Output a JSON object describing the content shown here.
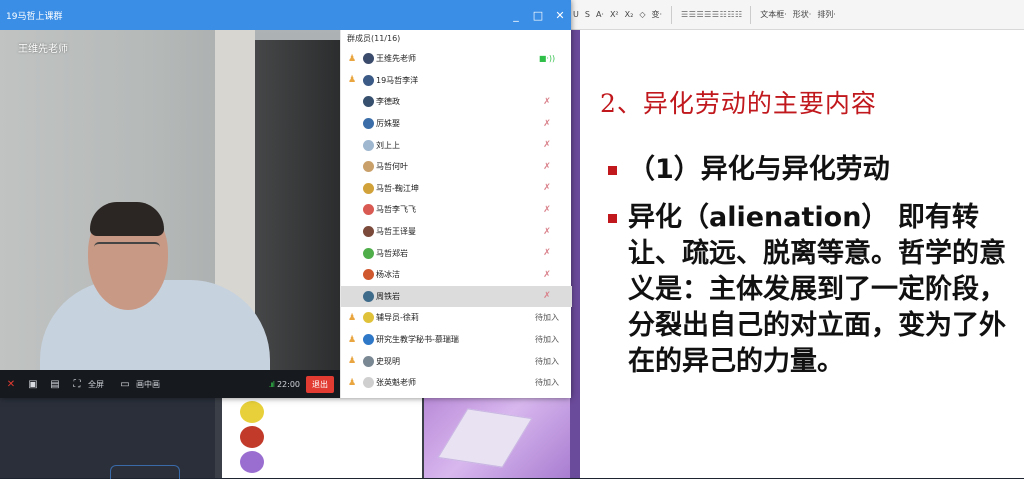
{
  "window": {
    "title": "19马哲上课群",
    "minimize": "_",
    "maximize": "□",
    "close": "✕"
  },
  "video": {
    "presenter": "王维先老师"
  },
  "toolbar": {
    "fullscreen": "全屏",
    "pip": "画中画",
    "signal": ".ııl",
    "time": "22:00",
    "exit": "退出"
  },
  "members": {
    "count": "群成员(11/16)",
    "items": [
      {
        "name": "王维先老师",
        "role": "owner",
        "status": "■·))",
        "avatar": "#3b4b6b",
        "style": "live"
      },
      {
        "name": "19马哲李洋",
        "role": "owner",
        "status": "",
        "avatar": "#3c5a86",
        "style": ""
      },
      {
        "name": "李德政",
        "role": "",
        "status": "✗",
        "avatar": "#36506e",
        "style": "muted"
      },
      {
        "name": "厉姝娶",
        "role": "",
        "status": "✗",
        "avatar": "#3b6ea8",
        "style": "muted"
      },
      {
        "name": "刘上上",
        "role": "",
        "status": "✗",
        "avatar": "#9fb7cf",
        "style": "muted"
      },
      {
        "name": "马哲何叶",
        "role": "",
        "status": "✗",
        "avatar": "#c9a06a",
        "style": "muted"
      },
      {
        "name": "马哲-鞠江坤",
        "role": "",
        "status": "✗",
        "avatar": "#d2a23a",
        "style": "muted"
      },
      {
        "name": "马哲李飞飞",
        "role": "",
        "status": "✗",
        "avatar": "#d95a52",
        "style": "muted"
      },
      {
        "name": "马哲王译曼",
        "role": "",
        "status": "✗",
        "avatar": "#7b4a3a",
        "style": "muted"
      },
      {
        "name": "马哲郑岩",
        "role": "",
        "status": "✗",
        "avatar": "#4fae4a",
        "style": "muted"
      },
      {
        "name": "杨冰洁",
        "role": "",
        "status": "✗",
        "avatar": "#d0582e",
        "style": "muted"
      },
      {
        "name": "周铁岩",
        "role": "",
        "status": "✗",
        "avatar": "#3f6b8a",
        "style": "muted"
      },
      {
        "name": "辅导员-徐莉",
        "role": "owner",
        "status": "待加入",
        "avatar": "#e0c23a",
        "style": ""
      },
      {
        "name": "研究生教学秘书-慕瑞瑞",
        "role": "owner",
        "status": "待加入",
        "avatar": "#2f78c8",
        "style": ""
      },
      {
        "name": "史现明",
        "role": "owner",
        "status": "待加入",
        "avatar": "#7a8894",
        "style": ""
      },
      {
        "name": "张英魁老师",
        "role": "owner",
        "status": "待加入",
        "avatar": "#cfcfcf",
        "style": ""
      }
    ]
  },
  "ppt_toolbar": {
    "items": [
      "U",
      "S",
      "A·",
      "X²",
      "X₂",
      "◇",
      "变·",
      "文本框·",
      "形状·",
      "排列·"
    ]
  },
  "slide": {
    "heading": "2、异化劳动的主要内容",
    "bullet1": "（1）异化与异化劳动",
    "bullet2": "异化（alienation） 即有转让、疏远、脱离等意。哲学的意义是：主体发展到了一定阶段，分裂出自己的对立面，变为了外在的异己的力量。"
  },
  "colors": {
    "title_bar": "#3a8ee6",
    "exit": "#e23b32",
    "heading": "#c0181d",
    "selected_row": "#dcdcdc"
  }
}
